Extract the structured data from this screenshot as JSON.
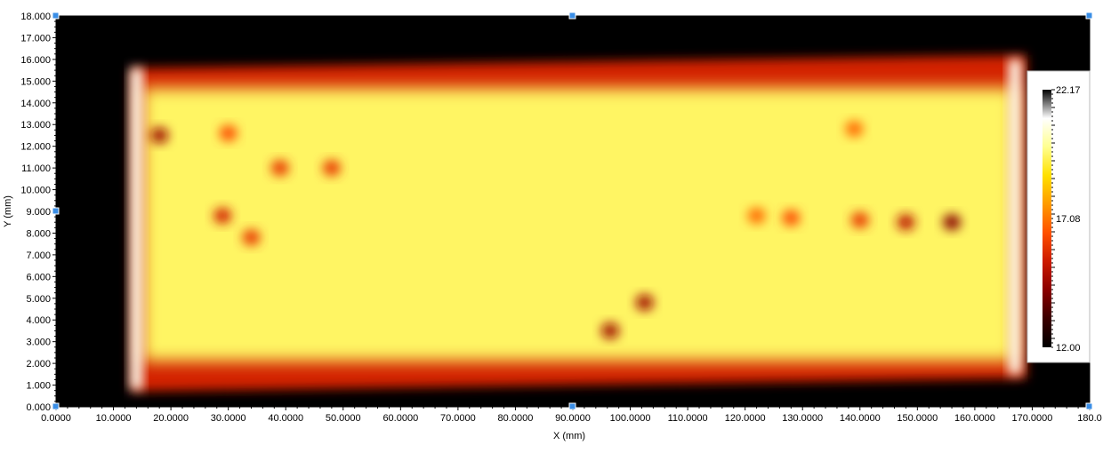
{
  "chart_data": {
    "type": "heatmap",
    "xlabel": "X (mm)",
    "ylabel": "Y (mm)",
    "xlim": [
      0,
      180
    ],
    "ylim": [
      0,
      18
    ],
    "x_ticks": [
      "0.0000",
      "10.0000",
      "20.0000",
      "30.0000",
      "40.0000",
      "50.0000",
      "60.0000",
      "70.0000",
      "80.0000",
      "90.0000",
      "100.0000",
      "110.0000",
      "120.0000",
      "130.0000",
      "140.0000",
      "150.0000",
      "160.0000",
      "170.0000",
      "180.0"
    ],
    "y_ticks": [
      "0.000",
      "1.000",
      "2.000",
      "3.000",
      "4.000",
      "5.000",
      "6.000",
      "7.000",
      "8.000",
      "9.000",
      "10.000",
      "11.000",
      "12.000",
      "13.000",
      "14.000",
      "15.000",
      "16.000",
      "17.000",
      "18.000"
    ],
    "colorbar": {
      "min": 12.0,
      "mid": 17.08,
      "max": 22.17,
      "labels": [
        "22.17",
        "17.08",
        "12.00"
      ]
    },
    "background_value": 12.0,
    "sample_region": {
      "x_range": [
        13.0,
        169.0
      ],
      "left_edge_y": [
        0.7,
        15.6
      ],
      "right_edge_y": [
        1.3,
        16.2
      ],
      "body_y_range": [
        1.1,
        15.9
      ],
      "core_value": 20.5,
      "edge_band_value": 16.0
    },
    "hot_edges": [
      {
        "x": 14.0,
        "y_range": [
          0.8,
          15.6
        ],
        "value": 22.0
      },
      {
        "x": 167.0,
        "y_range": [
          1.5,
          16.0
        ],
        "value": 22.0
      }
    ],
    "cool_features": [
      {
        "x": 18.0,
        "y": 12.5,
        "value": 15.0
      },
      {
        "x": 30.0,
        "y": 12.6,
        "value": 17.0
      },
      {
        "x": 39.0,
        "y": 11.0,
        "value": 16.5
      },
      {
        "x": 48.0,
        "y": 11.0,
        "value": 16.5
      },
      {
        "x": 29.0,
        "y": 8.8,
        "value": 16.0
      },
      {
        "x": 34.0,
        "y": 7.8,
        "value": 16.5
      },
      {
        "x": 96.5,
        "y": 3.5,
        "value": 15.0
      },
      {
        "x": 102.5,
        "y": 4.8,
        "value": 15.0
      },
      {
        "x": 122.0,
        "y": 8.8,
        "value": 17.5
      },
      {
        "x": 128.0,
        "y": 8.7,
        "value": 17.0
      },
      {
        "x": 140.0,
        "y": 8.6,
        "value": 16.5
      },
      {
        "x": 148.0,
        "y": 8.5,
        "value": 15.5
      },
      {
        "x": 156.0,
        "y": 8.5,
        "value": 14.5
      },
      {
        "x": 139.0,
        "y": 12.8,
        "value": 17.5
      }
    ],
    "grid": false,
    "legend": "colorbar right"
  },
  "colors": {
    "background": "#000000",
    "colormap": [
      "#000000",
      "#3a0000",
      "#8a0000",
      "#cc1a00",
      "#ff5000",
      "#ff9a00",
      "#ffe000",
      "#ffff90",
      "#ffffff",
      "#000000"
    ],
    "handle": "#3a8ee6"
  }
}
